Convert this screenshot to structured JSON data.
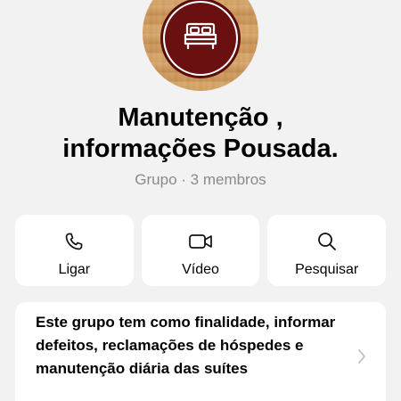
{
  "group": {
    "title_line1": "Manutenção ,",
    "title_line2": "informações Pousada.",
    "subtitle": "Grupo · 3 membros",
    "avatar_icon": "bed-icon"
  },
  "actions": [
    {
      "label": "Ligar",
      "icon": "phone-icon"
    },
    {
      "label": "Vídeo",
      "icon": "video-camera-icon"
    },
    {
      "label": "Pesquisar",
      "icon": "search-icon"
    }
  ],
  "description": {
    "text": "Este grupo tem como finalidade, informar defeitos, reclamações de hóspedes e manutenção diária das suítes"
  },
  "colors": {
    "background": "#f2f2f2",
    "card": "#ffffff",
    "secondary_text": "#8a8a8e",
    "avatar_badge": "#6a1010"
  }
}
